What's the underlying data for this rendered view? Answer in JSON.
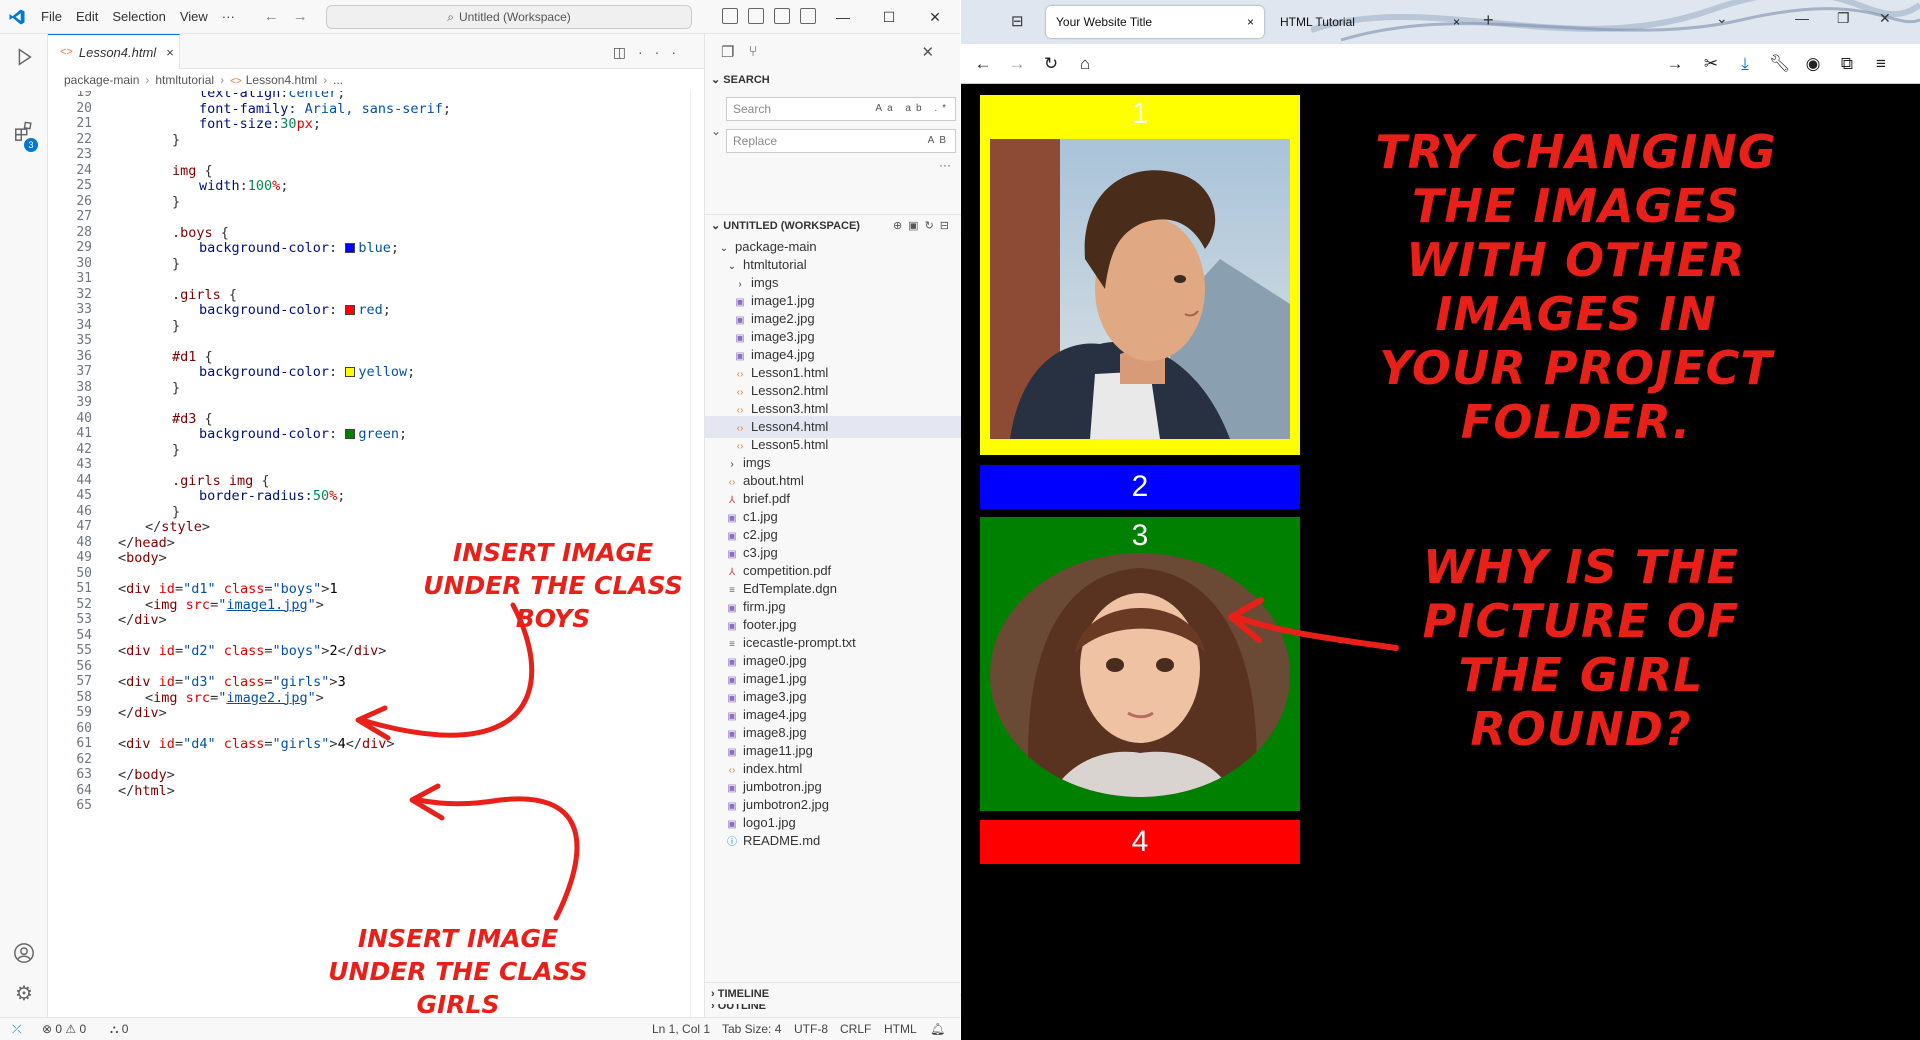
{
  "vscode": {
    "menu": [
      "File",
      "Edit",
      "Selection",
      "View",
      "···"
    ],
    "command_center": "Untitled (Workspace)",
    "tab": {
      "label": "Lesson4.html",
      "close": "×"
    },
    "breadcrumbs": [
      "package-main",
      "htmltutorial",
      "Lesson4.html",
      "..."
    ],
    "extensions_badge": "3",
    "code_lines": [
      {
        "n": "19",
        "html": "<span class='p'>text-align</span>:<span class='s'>center</span>;",
        "indent": 3
      },
      {
        "n": "20",
        "html": "<span class='p'>font-family</span>: <span class='s'>Arial, sans-serif</span>;",
        "indent": 3
      },
      {
        "n": "21",
        "html": "<span class='p'>font-size</span>:<span class='c'>30</span><span class='a'>px</span>;",
        "indent": 3
      },
      {
        "n": "22",
        "html": "}",
        "indent": 2
      },
      {
        "n": "23",
        "html": "",
        "indent": 0
      },
      {
        "n": "24",
        "html": "<span class='sel'>img</span> {",
        "indent": 2
      },
      {
        "n": "25",
        "html": "<span class='p'>width</span>:<span class='c'>100</span><span class='a'>%</span>;",
        "indent": 3
      },
      {
        "n": "26",
        "html": "}",
        "indent": 2
      },
      {
        "n": "27",
        "html": "",
        "indent": 0
      },
      {
        "n": "28",
        "html": "<span class='sel'>.boys</span> {",
        "indent": 2
      },
      {
        "n": "29",
        "html": "<span class='p'>background-color</span>: <span class='sw' style='background:#0000ff'></span><span class='s'>blue</span>;",
        "indent": 3
      },
      {
        "n": "30",
        "html": "}",
        "indent": 2
      },
      {
        "n": "31",
        "html": "",
        "indent": 0
      },
      {
        "n": "32",
        "html": "<span class='sel'>.girls</span> {",
        "indent": 2
      },
      {
        "n": "33",
        "html": "<span class='p'>background-color</span>: <span class='sw' style='background:#ff0000'></span><span class='s'>red</span>;",
        "indent": 3
      },
      {
        "n": "34",
        "html": "}",
        "indent": 2
      },
      {
        "n": "35",
        "html": "",
        "indent": 0
      },
      {
        "n": "36",
        "html": "<span class='sel'>#d1</span> {",
        "indent": 2
      },
      {
        "n": "37",
        "html": "<span class='p'>background-color</span>: <span class='sw' style='background:#ffff00'></span><span class='s'>yellow</span>;",
        "indent": 3
      },
      {
        "n": "38",
        "html": "}",
        "indent": 2
      },
      {
        "n": "39",
        "html": "",
        "indent": 0
      },
      {
        "n": "40",
        "html": "<span class='sel'>#d3</span> {",
        "indent": 2
      },
      {
        "n": "41",
        "html": "<span class='p'>background-color</span>: <span class='sw' style='background:#008000'></span><span class='s'>green</span>;",
        "indent": 3
      },
      {
        "n": "42",
        "html": "}",
        "indent": 2
      },
      {
        "n": "43",
        "html": "",
        "indent": 0
      },
      {
        "n": "44",
        "html": "<span class='sel'>.girls img</span> {",
        "indent": 2
      },
      {
        "n": "45",
        "html": "<span class='p'>border-radius</span>:<span class='c'>50</span><span class='a'>%</span>;",
        "indent": 3
      },
      {
        "n": "46",
        "html": "}",
        "indent": 2
      },
      {
        "n": "47",
        "html": "&lt;/<span class='k'>style</span>&gt;",
        "indent": 1
      },
      {
        "n": "48",
        "html": "&lt;/<span class='k'>head</span>&gt;",
        "indent": 0
      },
      {
        "n": "49",
        "html": "&lt;<span class='k'>body</span>&gt;",
        "indent": 0
      },
      {
        "n": "50",
        "html": "",
        "indent": 0
      },
      {
        "n": "51",
        "html": "&lt;<span class='k'>div</span> <span class='a'>id</span>=<span class='s'>\"d1\"</span> <span class='a'>class</span>=<span class='s'>\"boys\"</span>&gt;<span class='t'>1</span>",
        "indent": 0
      },
      {
        "n": "52",
        "html": "&lt;<span class='k'>img</span> <span class='a'>src</span>=<span class='s'>\"<span class='u'>image1.jpg</span>\"</span>&gt;",
        "indent": 1
      },
      {
        "n": "53",
        "html": "&lt;/<span class='k'>div</span>&gt;",
        "indent": 0
      },
      {
        "n": "54",
        "html": "",
        "indent": 0
      },
      {
        "n": "55",
        "html": "&lt;<span class='k'>div</span> <span class='a'>id</span>=<span class='s'>\"d2\"</span> <span class='a'>class</span>=<span class='s'>\"boys\"</span>&gt;<span class='t'>2</span>&lt;/<span class='k'>div</span>&gt;",
        "indent": 0
      },
      {
        "n": "56",
        "html": "",
        "indent": 0
      },
      {
        "n": "57",
        "html": "&lt;<span class='k'>div</span> <span class='a'>id</span>=<span class='s'>\"d3\"</span> <span class='a'>class</span>=<span class='s'>\"girls\"</span>&gt;<span class='t'>3</span>",
        "indent": 0
      },
      {
        "n": "58",
        "html": "&lt;<span class='k'>img</span> <span class='a'>src</span>=<span class='s'>\"<span class='u'>image2.jpg</span>\"</span>&gt;",
        "indent": 1
      },
      {
        "n": "59",
        "html": "&lt;/<span class='k'>div</span>&gt;",
        "indent": 0
      },
      {
        "n": "60",
        "html": "",
        "indent": 0
      },
      {
        "n": "61",
        "html": "&lt;<span class='k'>div</span> <span class='a'>id</span>=<span class='s'>\"d4\"</span> <span class='a'>class</span>=<span class='s'>\"girls\"</span>&gt;<span class='t'>4</span>&lt;/<span class='k'>div</span>&gt;",
        "indent": 0
      },
      {
        "n": "62",
        "html": "",
        "indent": 0
      },
      {
        "n": "63",
        "html": "&lt;/<span class='k'>body</span>&gt;",
        "indent": 0
      },
      {
        "n": "64",
        "html": "&lt;/<span class='k'>html</span>&gt;",
        "indent": 0
      },
      {
        "n": "65",
        "html": "",
        "indent": 0
      }
    ],
    "sidebar": {
      "search_title": "SEARCH",
      "search_placeholder": "Search",
      "replace_placeholder": "Replace",
      "search_opts": "Aa ab .*",
      "replace_opts": "AB",
      "workspace_title": "UNTITLED (WORKSPACE)",
      "tree": [
        {
          "label": "package-main",
          "depth": 0,
          "type": "folder-open"
        },
        {
          "label": "htmltutorial",
          "depth": 1,
          "type": "folder-open"
        },
        {
          "label": "imgs",
          "depth": 2,
          "type": "folder"
        },
        {
          "label": "image1.jpg",
          "depth": 2,
          "type": "img"
        },
        {
          "label": "image2.jpg",
          "depth": 2,
          "type": "img"
        },
        {
          "label": "image3.jpg",
          "depth": 2,
          "type": "img"
        },
        {
          "label": "image4.jpg",
          "depth": 2,
          "type": "img"
        },
        {
          "label": "Lesson1.html",
          "depth": 2,
          "type": "html"
        },
        {
          "label": "Lesson2.html",
          "depth": 2,
          "type": "html"
        },
        {
          "label": "Lesson3.html",
          "depth": 2,
          "type": "html"
        },
        {
          "label": "Lesson4.html",
          "depth": 2,
          "type": "html",
          "selected": true
        },
        {
          "label": "Lesson5.html",
          "depth": 2,
          "type": "html"
        },
        {
          "label": "imgs",
          "depth": 1,
          "type": "folder"
        },
        {
          "label": "about.html",
          "depth": 1,
          "type": "html"
        },
        {
          "label": "brief.pdf",
          "depth": 1,
          "type": "pdf"
        },
        {
          "label": "c1.jpg",
          "depth": 1,
          "type": "img"
        },
        {
          "label": "c2.jpg",
          "depth": 1,
          "type": "img"
        },
        {
          "label": "c3.jpg",
          "depth": 1,
          "type": "img"
        },
        {
          "label": "competition.pdf",
          "depth": 1,
          "type": "pdf"
        },
        {
          "label": "EdTemplate.dgn",
          "depth": 1,
          "type": "txt"
        },
        {
          "label": "firm.jpg",
          "depth": 1,
          "type": "img"
        },
        {
          "label": "footer.jpg",
          "depth": 1,
          "type": "img"
        },
        {
          "label": "icecastle-prompt.txt",
          "depth": 1,
          "type": "txt"
        },
        {
          "label": "image0.jpg",
          "depth": 1,
          "type": "img"
        },
        {
          "label": "image1.jpg",
          "depth": 1,
          "type": "img"
        },
        {
          "label": "image3.jpg",
          "depth": 1,
          "type": "img"
        },
        {
          "label": "image4.jpg",
          "depth": 1,
          "type": "img"
        },
        {
          "label": "image8.jpg",
          "depth": 1,
          "type": "img"
        },
        {
          "label": "image11.jpg",
          "depth": 1,
          "type": "img"
        },
        {
          "label": "index.html",
          "depth": 1,
          "type": "html"
        },
        {
          "label": "jumbotron.jpg",
          "depth": 1,
          "type": "img"
        },
        {
          "label": "jumbotron2.jpg",
          "depth": 1,
          "type": "img"
        },
        {
          "label": "logo1.jpg",
          "depth": 1,
          "type": "img"
        },
        {
          "label": "README.md",
          "depth": 1,
          "type": "info"
        }
      ],
      "outline": "OUTLINE",
      "timeline": "TIMELINE"
    },
    "status": {
      "errors": "⊗ 0 ⚠ 0",
      "ports": "⛬ 0",
      "position": "Ln 1, Col 1",
      "tabsize": "Tab Size: 4",
      "encoding": "UTF-8",
      "eol": "CRLF",
      "language": "HTML"
    },
    "annotations": {
      "boys": "INSERT IMAGE UNDER THE CLASS BOYS",
      "girls": "INSERT IMAGE UNDER THE CLASS GIRLS"
    }
  },
  "browser": {
    "tabs": [
      {
        "label": "Your Website Title",
        "close": "×"
      },
      {
        "label": "HTML Tutorial",
        "close": "×"
      }
    ],
    "new_tab": "+",
    "boxes": [
      {
        "label": "1",
        "color": "#ffff00"
      },
      {
        "label": "2",
        "color": "#0000ff"
      },
      {
        "label": "3",
        "color": "#008000"
      },
      {
        "label": "4",
        "color": "#ff0000"
      }
    ],
    "annotation_top": "TRY CHANGING THE IMAGES WITH OTHER IMAGES IN YOUR PROJECT FOLDER.",
    "annotation_bottom": "WHY IS THE PICTURE OF THE GIRL ROUND?"
  },
  "colors": {
    "accent": "#0078d4",
    "annotation": "#e8201a"
  }
}
